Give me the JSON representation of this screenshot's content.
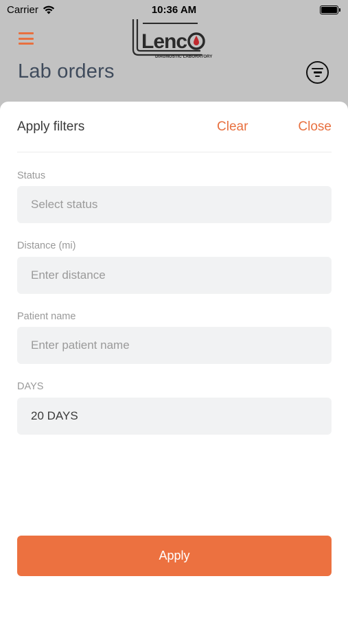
{
  "status_bar": {
    "carrier": "Carrier",
    "time": "10:36 AM",
    "wifi_icon": "wifi-icon",
    "battery_icon": "battery-icon"
  },
  "header": {
    "menu_icon": "hamburger-menu-icon",
    "logo_text": "LENCO",
    "logo_subtext": "DIAGNOSTIC LABORATORY",
    "title": "Lab orders",
    "filter_icon": "filter-icon"
  },
  "filters": {
    "title": "Apply filters",
    "clear_label": "Clear",
    "close_label": "Close",
    "status": {
      "label": "Status",
      "placeholder": "Select status"
    },
    "distance": {
      "label": "Distance (mi)",
      "placeholder": "Enter distance"
    },
    "patient_name": {
      "label": "Patient name",
      "placeholder": "Enter patient name"
    },
    "days": {
      "label": "DAYS",
      "value": "20 DAYS"
    },
    "apply_label": "Apply"
  },
  "colors": {
    "accent": "#ec7140",
    "overlay": "#c2c2c2",
    "input_bg": "#f1f2f3",
    "title_text": "#3f4b5c"
  }
}
